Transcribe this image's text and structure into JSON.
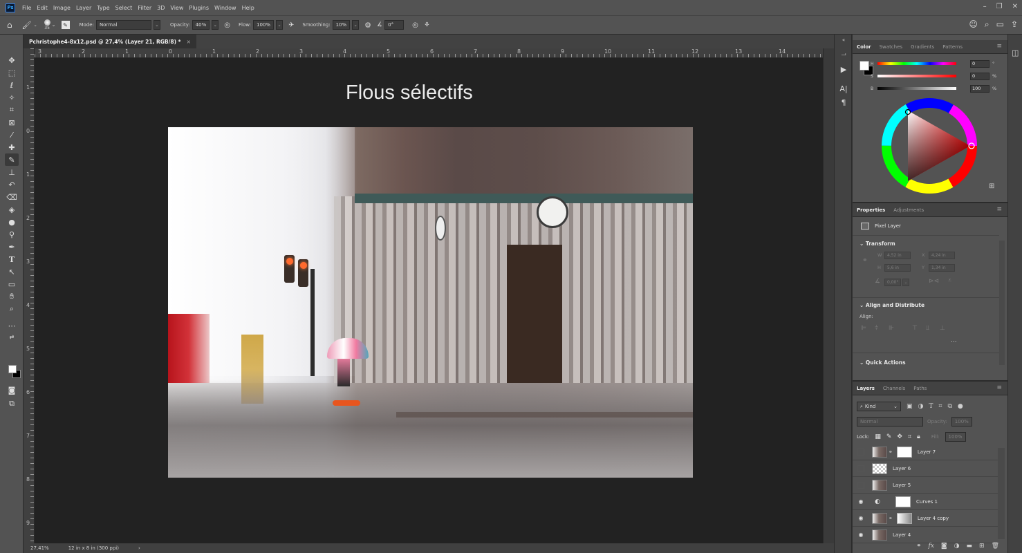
{
  "app": {
    "logo": "Ps",
    "menu": [
      "File",
      "Edit",
      "Image",
      "Layer",
      "Type",
      "Select",
      "Filter",
      "3D",
      "View",
      "Plugins",
      "Window",
      "Help"
    ]
  },
  "options": {
    "brush_size": "35",
    "mode_label": "Mode:",
    "mode_value": "Normal",
    "opacity_label": "Opacity:",
    "opacity_value": "40%",
    "flow_label": "Flow:",
    "flow_value": "100%",
    "smoothing_label": "Smoothing:",
    "smoothing_value": "10%",
    "angle_value": "0°"
  },
  "document": {
    "tab_title": "Pchristophe4-8x12.psd @ 27,4% (Layer 21, RGB/8) *",
    "close_glyph": "×",
    "canvas_title": "Flous sélectifs",
    "zoom": "27,41%",
    "doc_size": "12 in x 8 in (300 ppi)",
    "status_arrow": "›"
  },
  "rulers": {
    "horizontal": [
      "3",
      "2",
      "1",
      "0",
      "1",
      "2",
      "3",
      "4",
      "5",
      "6",
      "7",
      "8",
      "9",
      "10",
      "11",
      "12",
      "13",
      "14"
    ],
    "vertical": [
      "1",
      "0",
      "1",
      "2",
      "3",
      "4",
      "5",
      "6",
      "7",
      "8",
      "9"
    ]
  },
  "color_panel": {
    "tabs": [
      "Color",
      "Swatches",
      "Gradients",
      "Patterns"
    ],
    "h": {
      "letter": "H",
      "value": "0",
      "unit": "°"
    },
    "s": {
      "letter": "S",
      "value": "0",
      "unit": "%"
    },
    "b": {
      "letter": "B",
      "value": "100",
      "unit": "%"
    },
    "fg_color": "#ffffff",
    "bg_color": "#000000"
  },
  "properties_panel": {
    "tabs": [
      "Properties",
      "Adjustments"
    ],
    "layer_kind": "Pixel Layer",
    "transform": {
      "title": "Transform",
      "w_label": "W",
      "w": "4,52 in",
      "x_label": "X",
      "x": "4,24 in",
      "h_label": "H",
      "h": "5,6 in",
      "y_label": "Y",
      "y": "1,34 in",
      "angle": "0,00°"
    },
    "align": {
      "title": "Align and Distribute",
      "label": "Align:",
      "more": "..."
    },
    "quick_actions": "Quick Actions"
  },
  "layers_panel": {
    "tabs": [
      "Layers",
      "Channels",
      "Paths"
    ],
    "filter": "Kind",
    "blend_mode": "Normal",
    "opacity_label": "Opacity:",
    "opacity_value": "100%",
    "lock_label": "Lock:",
    "fill_label": "Fill:",
    "fill_value": "100%",
    "layers": [
      {
        "name": "Layer 7",
        "visible": false
      },
      {
        "name": "Layer 6",
        "visible": false
      },
      {
        "name": "Layer 5",
        "visible": false
      },
      {
        "name": "Curves 1",
        "visible": true
      },
      {
        "name": "Layer 4 copy",
        "visible": true
      },
      {
        "name": "Layer 4",
        "visible": true
      }
    ]
  }
}
